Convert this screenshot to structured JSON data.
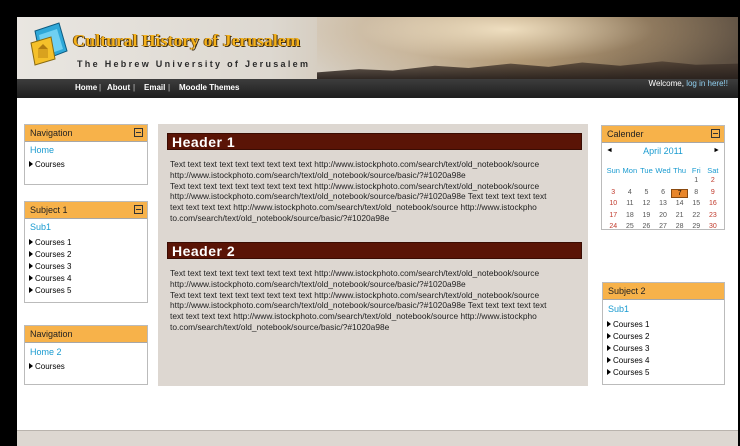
{
  "header": {
    "title": "Cultural History of Jerusalem",
    "subtitle": "The Hebrew University of Jerusalem"
  },
  "nav": {
    "items": [
      "Home",
      "About",
      "Email",
      "Moodle Themes"
    ],
    "separator": "|",
    "welcome_prefix": "Welcome,",
    "login_link": "log in here!!"
  },
  "left": {
    "navigation1": {
      "title": "Navigation",
      "link": "Home",
      "items": [
        "Courses"
      ]
    },
    "subject1": {
      "title": "Subject 1",
      "link": "Sub1",
      "items": [
        "Courses 1",
        "Courses 2",
        "Courses 3",
        "Courses 4",
        "Courses 5"
      ]
    },
    "navigation2": {
      "title": "Navigation",
      "link": "Home 2",
      "items": [
        "Courses"
      ]
    }
  },
  "main": {
    "sections": [
      {
        "header": "Header 1",
        "lines": [
          "Text text text text text text text text text http://www.istockphoto.com/search/text/old_notebook/source",
          "http://www.istockphoto.com/search/text/old_notebook/source/basic/?#1020a98e",
          "Text text text text text text text text text http://www.istockphoto.com/search/text/old_notebook/source",
          "http://www.istockphoto.com/search/text/old_notebook/source/basic/?#1020a98e Text text text text text",
          " text text text text http://www.istockphoto.com/search/text/old_notebook/source http://www.istockpho",
          "to.com/search/text/old_notebook/source/basic/?#1020a98e"
        ]
      },
      {
        "header": "Header 2",
        "lines": [
          "Text text text text text text text text text http://www.istockphoto.com/search/text/old_notebook/source",
          "http://www.istockphoto.com/search/text/old_notebook/source/basic/?#1020a98e",
          "Text text text text text text text text text http://www.istockphoto.com/search/text/old_notebook/source",
          "http://www.istockphoto.com/search/text/old_notebook/source/basic/?#1020a98e Text text text text text",
          " text text text text http://www.istockphoto.com/search/text/old_notebook/source http://www.istockpho",
          "to.com/search/text/old_notebook/source/basic/?#1020a98e"
        ]
      }
    ]
  },
  "calendar": {
    "title": "Calender",
    "prev": "◄",
    "next": "►",
    "month": "April 2011",
    "weekdays": [
      "Sun",
      "Mon",
      "Tue",
      "Wed",
      "Thu",
      "Fri",
      "Sat"
    ],
    "weeks": [
      [
        "",
        "",
        "",
        "",
        "",
        "1",
        "2"
      ],
      [
        "3",
        "4",
        "5",
        "6",
        "7",
        "8",
        "9"
      ],
      [
        "10",
        "11",
        "12",
        "13",
        "14",
        "15",
        "16"
      ],
      [
        "17",
        "18",
        "19",
        "20",
        "21",
        "22",
        "23"
      ],
      [
        "24",
        "25",
        "26",
        "27",
        "28",
        "29",
        "30"
      ]
    ],
    "today": "7"
  },
  "right": {
    "subject2": {
      "title": "Subject 2",
      "link": "Sub1",
      "items": [
        "Courses 1",
        "Courses 2",
        "Courses 3",
        "Courses 4",
        "Courses 5"
      ]
    }
  },
  "colors": {
    "block_header": "#f7b24a",
    "link": "#1a9bd0",
    "main_bg": "#ddd7d1",
    "section_header": "#5a1406",
    "weekend": "#c0392b",
    "today": "#e8862b"
  }
}
